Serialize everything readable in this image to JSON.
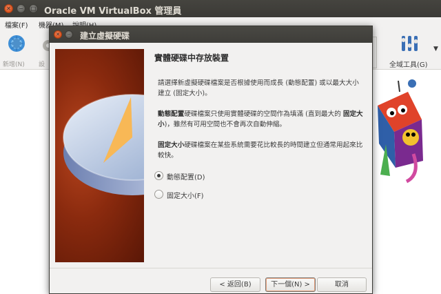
{
  "window": {
    "title": "Oracle VM VirtualBox 管理員"
  },
  "menu": [
    "檔案(F)",
    "機器(M)",
    "說明(H)"
  ],
  "toolbar": {
    "new_label": "新增(N)",
    "settings_label": "設",
    "global_tools_label": "全域工具(G)"
  },
  "dialog": {
    "title": "建立虛擬硬碟",
    "heading": "實體硬碟中存放裝置",
    "para1": "請選擇新虛擬硬碟檔案是否根據使用而成長 (動態配置) 或以最大大小建立 (固定大小)。",
    "para2": {
      "b1": "動態配置",
      "t1": "硬碟檔案只使用實體硬碟的空間作為填滿 (直到最大的 ",
      "b2": "固定大小",
      "t2": ")，雖然有可用空間也不會再次自動伸縮。"
    },
    "para3": {
      "b1": "固定大小",
      "t1": "硬碟檔案在某些系統需要花比較長的時間建立但通常用起來比較快。"
    },
    "options": [
      {
        "label": "動態配置(D)",
        "selected": true
      },
      {
        "label": "固定大小(F)",
        "selected": false
      }
    ],
    "buttons": {
      "back": "< 返回(B)",
      "next": "下一個(N) >",
      "cancel": "取消"
    }
  },
  "colors": {
    "accent": "#e9a27f",
    "titlebar": "#3b3a36",
    "close": "#d9531e"
  }
}
